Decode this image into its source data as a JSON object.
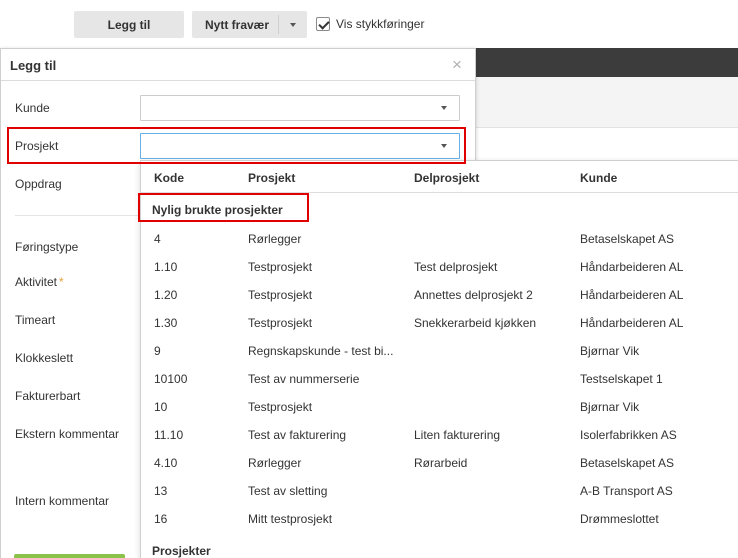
{
  "toolbar": {
    "add_label": "Legg til",
    "absence_label": "Nytt fravær",
    "show_items_label": "Vis stykkføringer",
    "show_items_checked": true
  },
  "dialog": {
    "title": "Legg til",
    "close_glyph": "×",
    "fields": {
      "customer": "Kunde",
      "project": "Prosjekt",
      "assignment": "Oppdrag",
      "entry_type": "Føringstype",
      "activity": "Aktivitet",
      "required_mark": "*",
      "hour_type": "Timeart",
      "clock_time": "Klokkeslett",
      "billable": "Fakturerbart",
      "external_comment": "Ekstern kommentar",
      "internal_comment": "Intern kommentar"
    }
  },
  "dropdown": {
    "columns": [
      "Kode",
      "Prosjekt",
      "Delprosjekt",
      "Kunde"
    ],
    "recent_label": "Nylig brukte prosjekter",
    "projects_label": "Prosjekter",
    "rows": [
      [
        "4",
        "Rørlegger",
        "",
        "Betaselskapet AS"
      ],
      [
        "1.10",
        "Testprosjekt",
        "Test delprosjekt",
        "Håndarbeideren AL"
      ],
      [
        "1.20",
        "Testprosjekt",
        "Annettes delprosjekt 2",
        "Håndarbeideren AL"
      ],
      [
        "1.30",
        "Testprosjekt",
        "Snekkerarbeid kjøkken",
        "Håndarbeideren AL"
      ],
      [
        "9",
        "Regnskapskunde - test bi...",
        "",
        "Bjørnar Vik"
      ],
      [
        "10100",
        "Test av nummerserie",
        "",
        "Testselskapet 1"
      ],
      [
        "10",
        "Testprosjekt",
        "",
        "Bjørnar Vik"
      ],
      [
        "11.10",
        "Test av fakturering",
        "Liten fakturering",
        "Isolerfabrikken AS"
      ],
      [
        "4.10",
        "Rørlegger",
        "Rørarbeid",
        "Betaselskapet AS"
      ],
      [
        "13",
        "Test av sletting",
        "",
        "A-B Transport AS"
      ],
      [
        "16",
        "Mitt testprosjekt",
        "",
        "Drømmeslottet"
      ]
    ]
  },
  "colors": {
    "highlight": "#e00000",
    "focus_border": "#66afe9",
    "save_button": "#8bc34a",
    "header_band": "#3c3c3c"
  }
}
